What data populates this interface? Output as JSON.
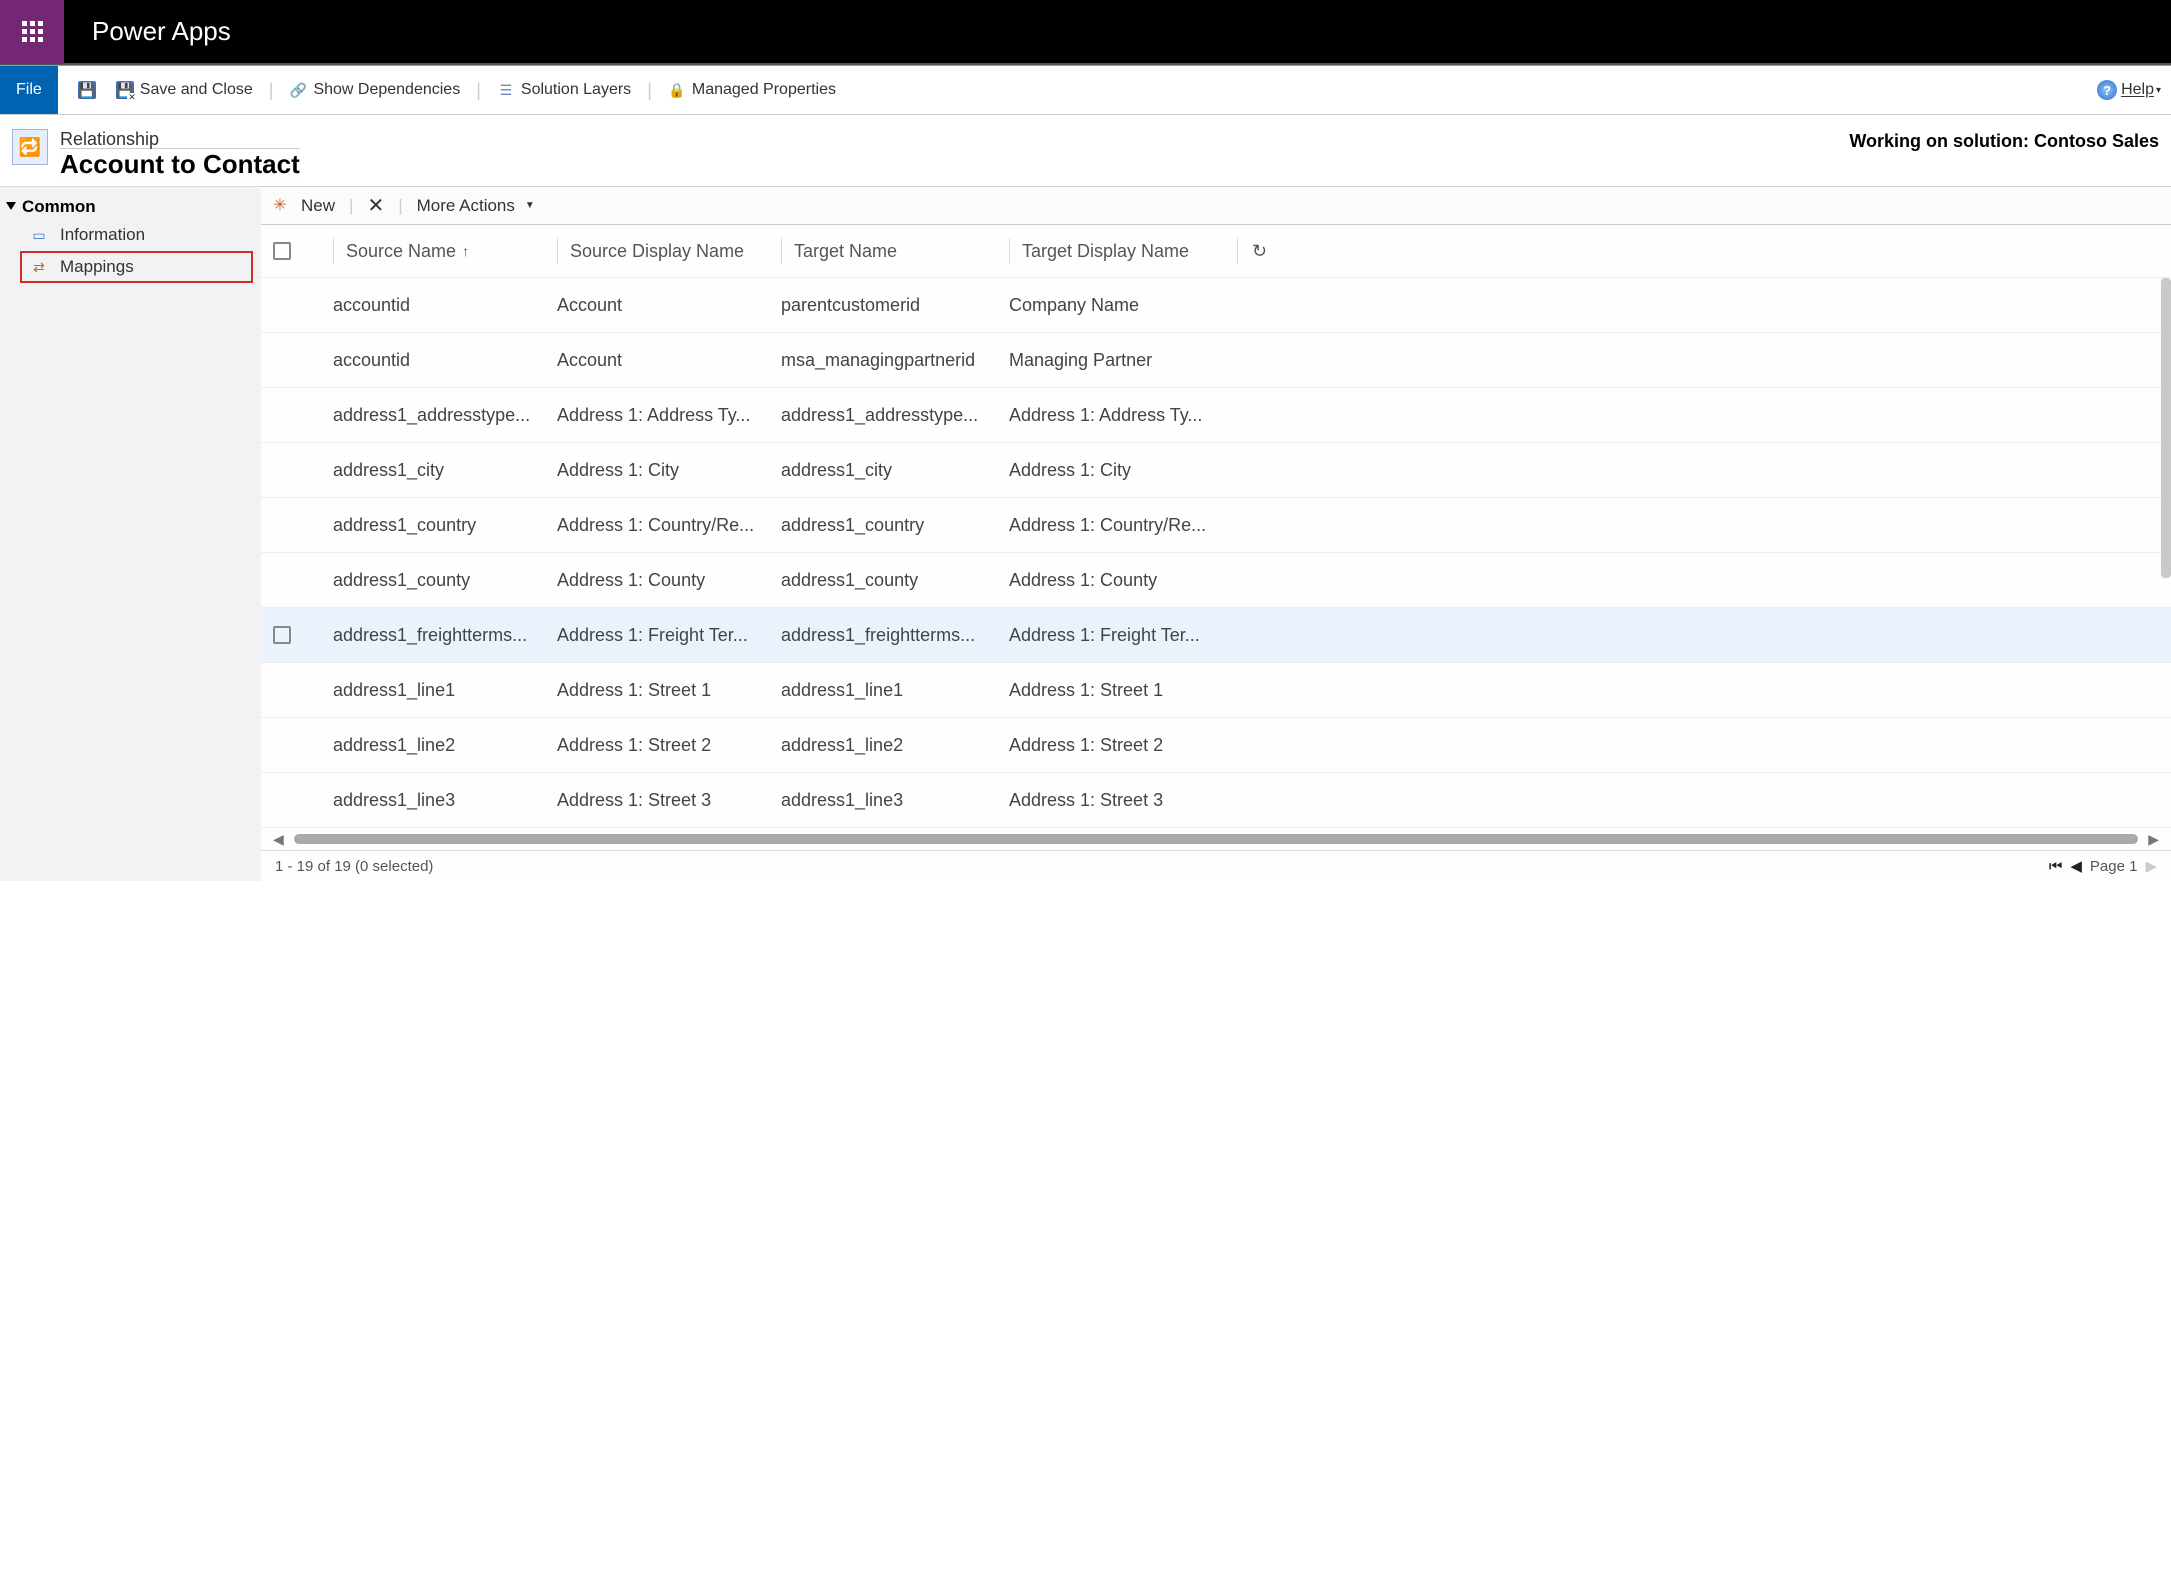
{
  "header": {
    "app_name": "Power Apps"
  },
  "ribbon": {
    "file": "File",
    "save_close": "Save and Close",
    "show_deps": "Show Dependencies",
    "solution_layers": "Solution Layers",
    "managed_props": "Managed Properties",
    "help": "Help"
  },
  "context": {
    "subtitle": "Relationship",
    "title": "Account to Contact",
    "solution_label": "Working on solution: Contoso Sales"
  },
  "sidebar": {
    "root": "Common",
    "items": [
      {
        "label": "Information"
      },
      {
        "label": "Mappings"
      }
    ]
  },
  "grid_toolbar": {
    "new": "New",
    "more_actions": "More Actions"
  },
  "grid": {
    "columns": [
      "Source Name",
      "Source Display Name",
      "Target Name",
      "Target Display Name"
    ],
    "rows": [
      {
        "sn": "accountid",
        "sdn": "Account",
        "tn": "parentcustomerid",
        "tdn": "Company Name"
      },
      {
        "sn": "accountid",
        "sdn": "Account",
        "tn": "msa_managingpartnerid",
        "tdn": "Managing Partner"
      },
      {
        "sn": "address1_addresstype...",
        "sdn": "Address 1: Address Ty...",
        "tn": "address1_addresstype...",
        "tdn": "Address 1: Address Ty..."
      },
      {
        "sn": "address1_city",
        "sdn": "Address 1: City",
        "tn": "address1_city",
        "tdn": "Address 1: City"
      },
      {
        "sn": "address1_country",
        "sdn": "Address 1: Country/Re...",
        "tn": "address1_country",
        "tdn": "Address 1: Country/Re..."
      },
      {
        "sn": "address1_county",
        "sdn": "Address 1: County",
        "tn": "address1_county",
        "tdn": "Address 1: County"
      },
      {
        "sn": "address1_freightterms...",
        "sdn": "Address 1: Freight Ter...",
        "tn": "address1_freightterms...",
        "tdn": "Address 1: Freight Ter...",
        "hovered": true
      },
      {
        "sn": "address1_line1",
        "sdn": "Address 1: Street 1",
        "tn": "address1_line1",
        "tdn": "Address 1: Street 1"
      },
      {
        "sn": "address1_line2",
        "sdn": "Address 1: Street 2",
        "tn": "address1_line2",
        "tdn": "Address 1: Street 2"
      },
      {
        "sn": "address1_line3",
        "sdn": "Address 1: Street 3",
        "tn": "address1_line3",
        "tdn": "Address 1: Street 3"
      }
    ]
  },
  "footer": {
    "status": "1 - 19 of 19 (0 selected)",
    "page_label": "Page 1"
  }
}
